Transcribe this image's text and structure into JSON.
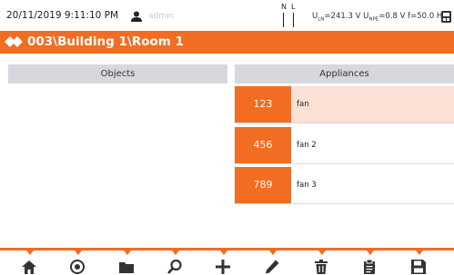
{
  "status": {
    "datetime": "20/11/2019 9:11:10 PM",
    "user": "admin",
    "nl_n": "N",
    "nl_l": "L",
    "u_ln_label": "U",
    "u_ln_sub": "LN",
    "u_ln_value": "=241.3 V",
    "u_npe_label": "U",
    "u_npe_sub": "NPE",
    "u_npe_value": "=0.8 V",
    "freq": "f=50.0 Hz"
  },
  "header": {
    "path": "003\\Building 1\\Room 1"
  },
  "columns": {
    "objects": "Objects",
    "appliances": "Appliances"
  },
  "appliances": [
    {
      "code": "123",
      "name": "fan"
    },
    {
      "code": "456",
      "name": "fan 2"
    },
    {
      "code": "789",
      "name": "fan 3"
    }
  ],
  "toolbar": {
    "buttons": [
      "home-icon",
      "target-icon",
      "folder-icon",
      "search-icon",
      "plus-icon",
      "pencil-icon",
      "trash-icon",
      "clipboard-icon",
      "save-icon"
    ]
  },
  "colors": {
    "accent": "#f26d21",
    "selected_row": "#fce0d6",
    "column_header": "#d7d8dd"
  }
}
